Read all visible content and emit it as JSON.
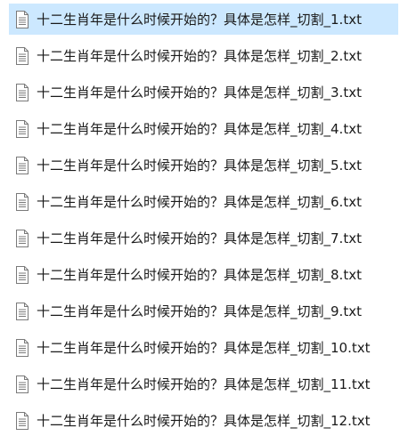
{
  "files": [
    {
      "name": "十二生肖年是什么时候开始的？具体是怎样_切割_1.txt",
      "icon": "text-document-icon",
      "selected": true
    },
    {
      "name": "十二生肖年是什么时候开始的？具体是怎样_切割_2.txt",
      "icon": "text-document-icon",
      "selected": false
    },
    {
      "name": "十二生肖年是什么时候开始的？具体是怎样_切割_3.txt",
      "icon": "text-document-icon",
      "selected": false
    },
    {
      "name": "十二生肖年是什么时候开始的？具体是怎样_切割_4.txt",
      "icon": "text-document-icon",
      "selected": false
    },
    {
      "name": "十二生肖年是什么时候开始的？具体是怎样_切割_5.txt",
      "icon": "text-document-icon",
      "selected": false
    },
    {
      "name": "十二生肖年是什么时候开始的？具体是怎样_切割_6.txt",
      "icon": "text-document-icon",
      "selected": false
    },
    {
      "name": "十二生肖年是什么时候开始的？具体是怎样_切割_7.txt",
      "icon": "text-document-icon",
      "selected": false
    },
    {
      "name": "十二生肖年是什么时候开始的？具体是怎样_切割_8.txt",
      "icon": "text-document-icon",
      "selected": false
    },
    {
      "name": "十二生肖年是什么时候开始的？具体是怎样_切割_9.txt",
      "icon": "text-document-icon",
      "selected": false
    },
    {
      "name": "十二生肖年是什么时候开始的？具体是怎样_切割_10.txt",
      "icon": "text-document-icon",
      "selected": false
    },
    {
      "name": "十二生肖年是什么时候开始的？具体是怎样_切割_11.txt",
      "icon": "text-document-icon",
      "selected": false
    },
    {
      "name": "十二生肖年是什么时候开始的？具体是怎样_切割_12.txt",
      "icon": "text-document-icon",
      "selected": false
    }
  ],
  "colors": {
    "selection": "#cce8ff",
    "text": "#1a1a1a",
    "icon_outline": "#7a7a7a"
  }
}
